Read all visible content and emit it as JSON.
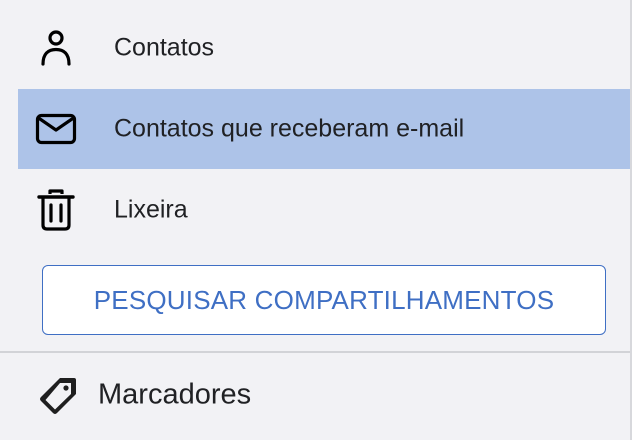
{
  "nav": {
    "items": [
      {
        "label": "Contatos",
        "icon": "person-icon",
        "selected": false
      },
      {
        "label": "Contatos que receberam e-mail",
        "icon": "mail-icon",
        "selected": true
      },
      {
        "label": "Lixeira",
        "icon": "trash-icon",
        "selected": false
      }
    ]
  },
  "search_button": {
    "label": "PESQUISAR COMPARTILHAMENTOS"
  },
  "labels_section": {
    "title": "Marcadores",
    "icon": "tag-icon"
  },
  "colors": {
    "selected_bg": "#adc3e8",
    "accent": "#3f6fc4",
    "text": "#202124",
    "panel_bg": "#f2f2f5"
  }
}
